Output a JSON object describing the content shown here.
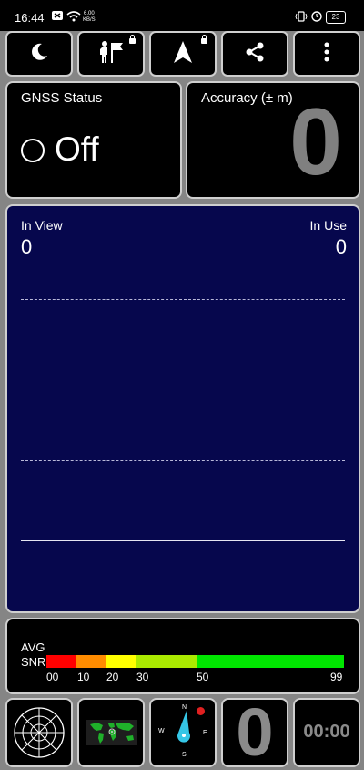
{
  "status_bar": {
    "time": "16:44",
    "speed_value": "6.00",
    "speed_unit": "KB/S",
    "battery": "23"
  },
  "toolbar": {
    "buttons": [
      {
        "name": "night-mode-button",
        "icon": "moon-icon"
      },
      {
        "name": "hiker-flag-button",
        "icon": "hiker-flag-icon",
        "locked": true
      },
      {
        "name": "navigation-button",
        "icon": "navigation-arrow-icon",
        "locked": true
      },
      {
        "name": "share-button",
        "icon": "share-icon"
      },
      {
        "name": "more-options-button",
        "icon": "more-vertical-icon"
      }
    ]
  },
  "gnss_status": {
    "title": "GNSS Status",
    "value": "Off"
  },
  "accuracy": {
    "title": "Accuracy (± m)",
    "value": "0"
  },
  "sky_view": {
    "in_view_label": "In View",
    "in_view_value": "0",
    "in_use_label": "In Use",
    "in_use_value": "0"
  },
  "snr": {
    "label_top": "AVG",
    "label_bottom": "SNR",
    "ticks": [
      "00",
      "10",
      "20",
      "30",
      "50",
      "99"
    ],
    "colors": {
      "red": "#ff0000",
      "orange": "#ff8c00",
      "yellow": "#ffff00",
      "lime": "#aaea00",
      "green": "#00e600"
    }
  },
  "bottom": {
    "radar_icon": "radar-icon",
    "map_icon": "world-map-icon",
    "compass": {
      "n": "N",
      "e": "E",
      "s": "S",
      "w": "W"
    },
    "big_value": "0",
    "timer": "00:00"
  },
  "colors": {
    "background": "#858585",
    "panel": "#000000",
    "sky": "#06074d",
    "border": "#cfcfcf"
  }
}
